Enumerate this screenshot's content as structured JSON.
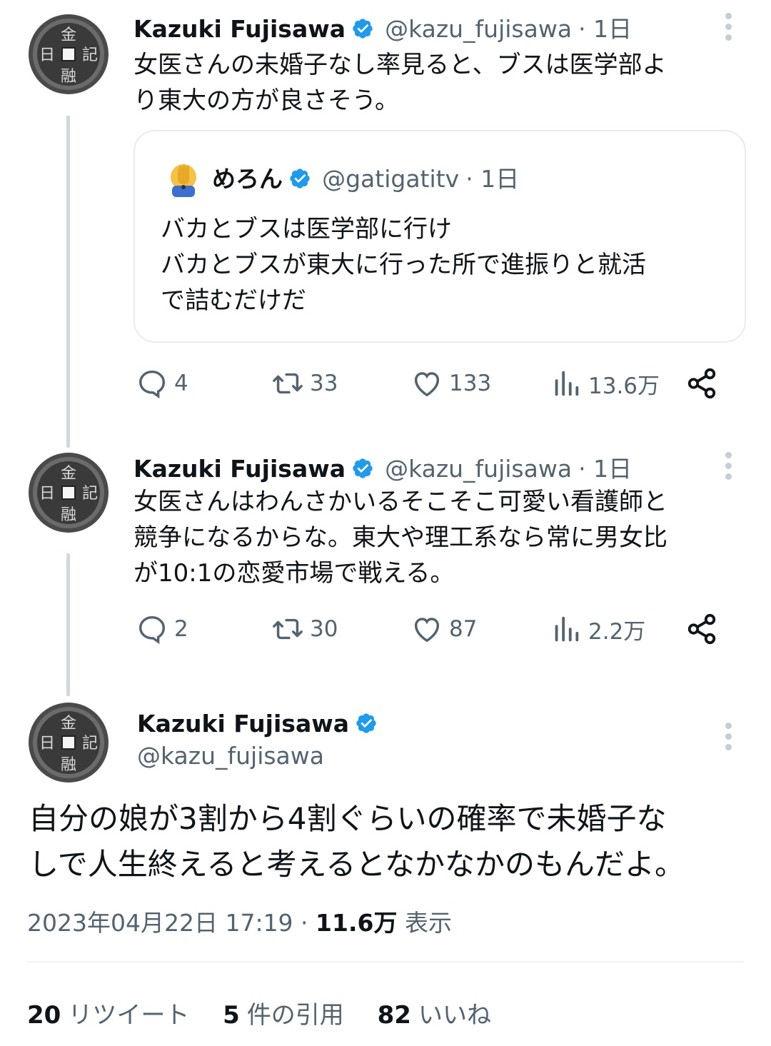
{
  "thread": [
    {
      "name": "Kazuki Fujisawa",
      "handle": "@kazu_fujisawa",
      "time": "· 1日",
      "text_lines": [
        "女医さんの未婚子なし率見ると、ブスは医学部よ",
        "り東大の方が良さそう。"
      ],
      "quote": {
        "name": "めろん",
        "handle": "@gatigatitv",
        "time": "· 1日",
        "text_lines": [
          "バカとブスは医学部に行け",
          "バカとブスが東大に行った所で進振りと就活",
          "で詰むだけだ"
        ]
      },
      "stats": {
        "replies": "4",
        "retweets": "33",
        "likes": "133",
        "views": "13.6万"
      }
    },
    {
      "name": "Kazuki Fujisawa",
      "handle": "@kazu_fujisawa",
      "time": "· 1日",
      "text_lines": [
        "女医さんはわんさかいるそこそこ可愛い看護師と",
        "競争になるからな。東大や理工系なら常に男女比",
        "が10:1の恋愛市場で戦える。"
      ],
      "stats": {
        "replies": "2",
        "retweets": "30",
        "likes": "87",
        "views": "2.2万"
      }
    }
  ],
  "main": {
    "name": "Kazuki Fujisawa",
    "handle": "@kazu_fujisawa",
    "text_lines": [
      "自分の娘が3割から4割ぐらいの確率で未婚子な",
      "しで人生終えると考えるとなかなかのもんだよ。"
    ],
    "date": "2023年04月22日 17:19 ·",
    "views_count": "11.6万",
    "views_label": "表示",
    "retweets_count": "20",
    "retweets_label": "リツイート",
    "quotes_count": "5",
    "quotes_label": "件の引用",
    "likes_count": "82",
    "likes_label": "いいね"
  },
  "colors": {
    "verified": "#1d9bf0",
    "muted": "#536471",
    "text": "#0f1419"
  }
}
